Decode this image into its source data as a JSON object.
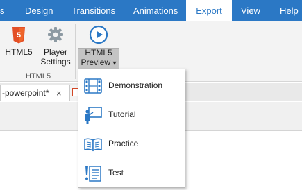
{
  "ribbon_tabs": {
    "partial": "s",
    "design": "Design",
    "transitions": "Transitions",
    "animations": "Animations",
    "export": "Export",
    "view": "View",
    "help": "Help"
  },
  "ribbon": {
    "html5_button": "HTML5",
    "player_settings_line1": "Player",
    "player_settings_line2": "Settings",
    "group_label": "HTML5",
    "preview_line1": "HTML5",
    "preview_line2": "Preview",
    "preview_arrow": "▾"
  },
  "document_tabs": {
    "active_tab": "-powerpoint*",
    "close_glyph": "×"
  },
  "dropdown": {
    "items": [
      {
        "label": "Demonstration",
        "icon": "film-icon"
      },
      {
        "label": "Tutorial",
        "icon": "presenter-icon"
      },
      {
        "label": "Practice",
        "icon": "open-book-icon"
      },
      {
        "label": "Test",
        "icon": "checklist-icon"
      }
    ]
  },
  "colors": {
    "accent": "#2b78c5",
    "html5_badge": "#e34f26",
    "gear": "#8d9aa3",
    "pressed_bg": "#c4c4c4"
  }
}
